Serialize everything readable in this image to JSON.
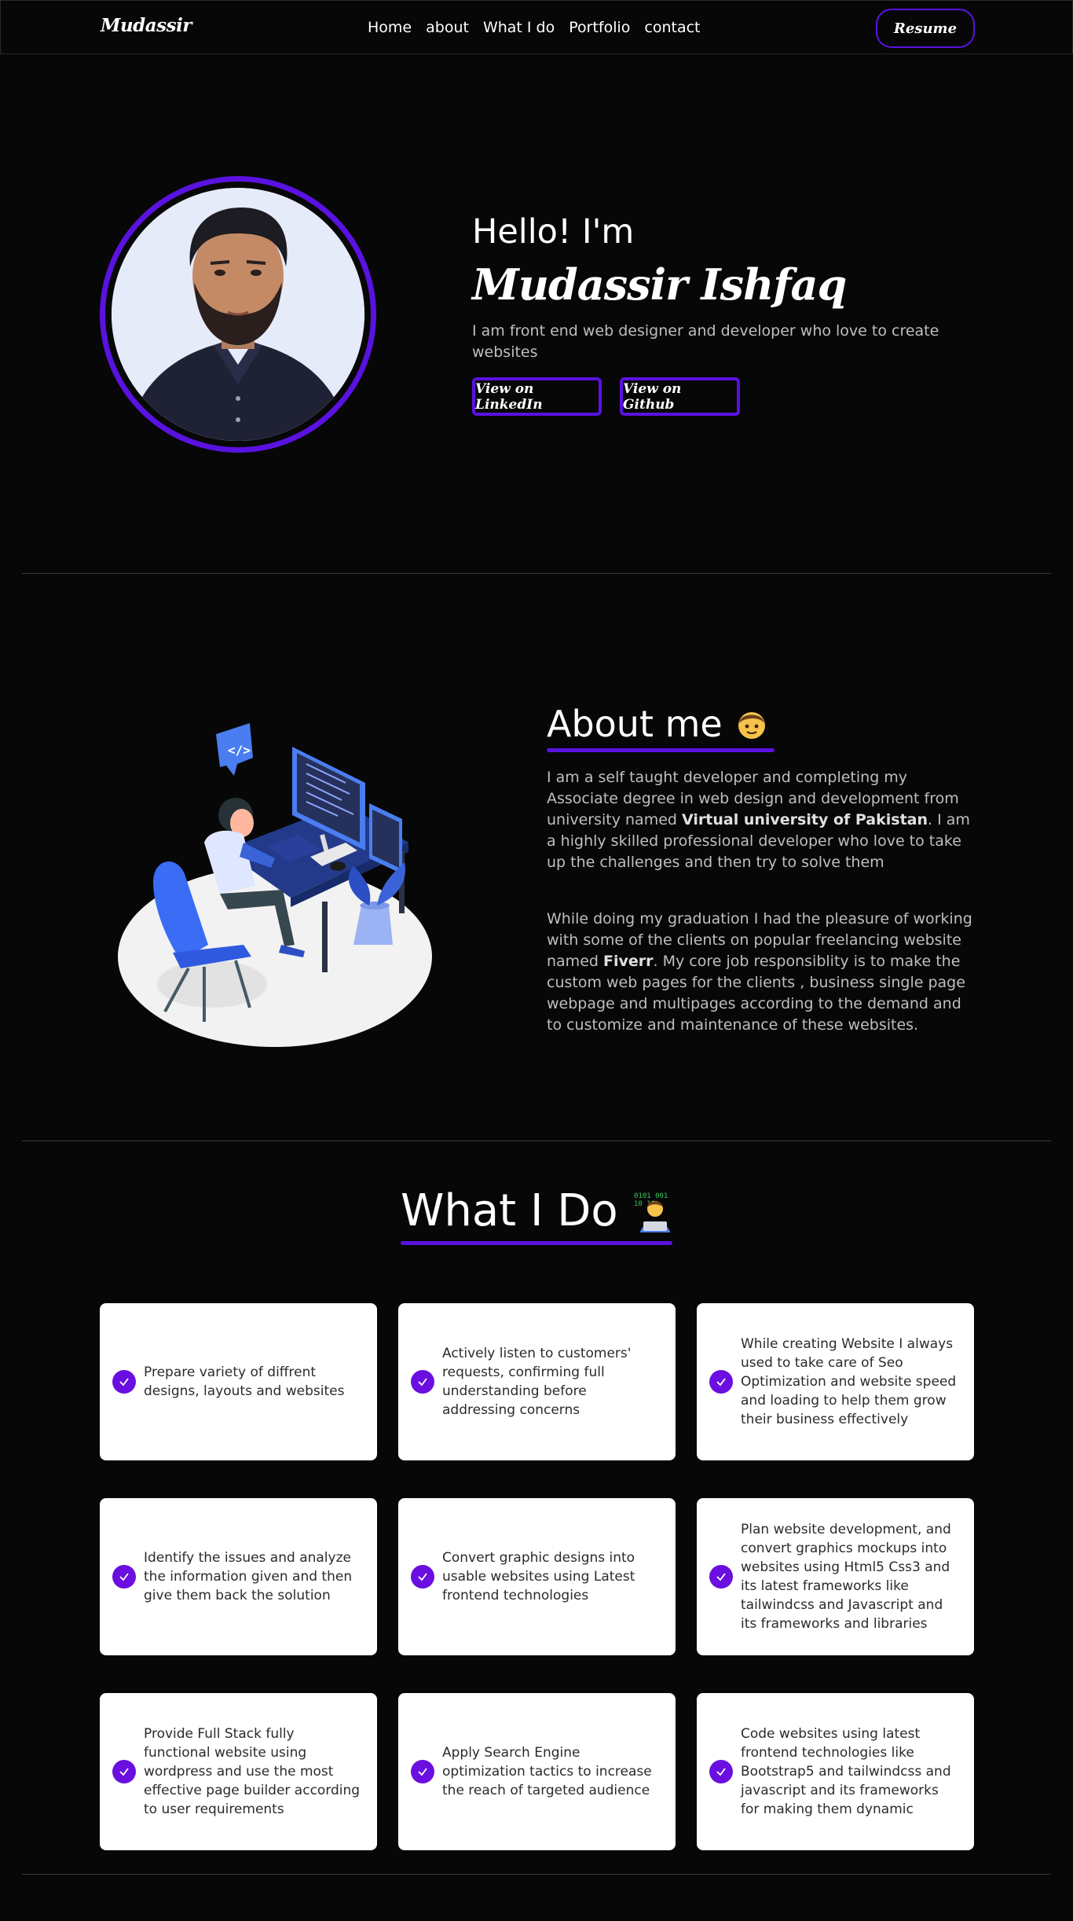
{
  "nav": {
    "logo": "Mudassir",
    "links": [
      "Home",
      "about",
      "What I do",
      "Portfolio",
      "contact"
    ],
    "resume_label": "Resume"
  },
  "hero": {
    "greeting": "Hello! I'm",
    "name": "Mudassir Ishfaq",
    "tagline": "I am front end web designer and developer who love to create websites",
    "linkedin_label": "View on LinkedIn",
    "github_label": "View on Github"
  },
  "about": {
    "title": "About me",
    "p1_before": "I am a self taught developer and completing my Associate degree in web design and development from university named ",
    "p1_bold": "Virtual university of Pakistan",
    "p1_after": ". I am a highly skilled professional developer who love to take up the challenges and then try to solve them",
    "p2_before": "While doing my graduation I had the pleasure of working with some of the clients on popular freelancing website named ",
    "p2_bold": "Fiverr",
    "p2_after": ". My core job responsiblity is to make the custom web pages for the clients , business single page webpage and multipages according to the demand and to customize and maintenance of these websites."
  },
  "what_i_do": {
    "title": "What I Do",
    "cards": [
      "Prepare variety of diffrent designs, layouts and websites",
      "Actively listen to customers' requests, confirming full understanding before addressing concerns",
      "While creating Website I always used to take care of Seo Optimization and website speed and loading to help them grow their business effectively",
      "Identify the issues and analyze the information given and then give them back the solution",
      "Convert graphic designs into usable websites using Latest frontend technologies",
      "Plan website development, and convert graphics mockups into websites using Html5 Css3 and its latest frameworks like tailwindcss and Javascript and its frameworks and libraries",
      "Provide Full Stack fully functional website using wordpress and use the most effective page builder according to user requirements",
      "Apply Search Engine optimization tactics to increase the reach of targeted audience",
      "Code websites using latest frontend technologies like Bootstrap5 and tailwindcss and javascript and its frameworks for making them dynamic"
    ]
  },
  "colors": {
    "accent": "#5a12e0",
    "check": "#6a0fe0",
    "background": "#070707",
    "card": "#ffffff"
  }
}
